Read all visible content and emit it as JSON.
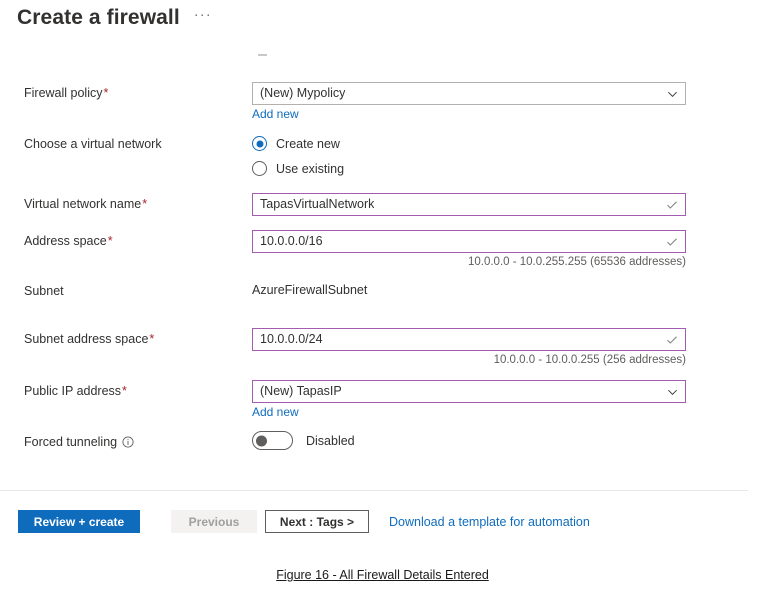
{
  "header": {
    "title": "Create a firewall",
    "more_label": "···"
  },
  "form": {
    "fields": {
      "firewall_policy": {
        "label": "Firewall policy",
        "required_mark": "*",
        "value": "(New) Mypolicy",
        "add_new_label": "Add new",
        "control": "dropdown",
        "border_color": "#b3b0ad"
      },
      "choose_vnet": {
        "label": "Choose a virtual network",
        "options": [
          {
            "label": "Create new",
            "selected": true
          },
          {
            "label": "Use existing",
            "selected": false
          }
        ]
      },
      "vnet_name": {
        "label": "Virtual network name",
        "required_mark": "*",
        "value": "TapasVirtualNetwork",
        "control": "textbox",
        "border_color": "#a35cb0",
        "validation_icon": "checkmark-icon"
      },
      "address_space": {
        "label": "Address space",
        "required_mark": "*",
        "value": "10.0.0.0/16",
        "control": "textbox",
        "border_color": "#a35cb0",
        "validation_icon": "checkmark-icon",
        "helper": "10.0.0.0 - 10.0.255.255 (65536 addresses)"
      },
      "subnet": {
        "label": "Subnet",
        "value": "AzureFirewallSubnet"
      },
      "subnet_address_space": {
        "label": "Subnet address space",
        "required_mark": "*",
        "value": "10.0.0.0/24",
        "control": "textbox",
        "border_color": "#a35cb0",
        "validation_icon": "checkmark-icon",
        "helper": "10.0.0.0 - 10.0.0.255 (256 addresses)"
      },
      "public_ip": {
        "label": "Public IP address",
        "required_mark": "*",
        "value": "(New) TapasIP",
        "add_new_label": "Add new",
        "control": "dropdown",
        "border_color": "#a35cb0"
      },
      "forced_tunneling": {
        "label": "Forced tunneling",
        "info_icon": "info-icon",
        "state_label": "Disabled",
        "enabled": false
      }
    }
  },
  "footer": {
    "review_create_label": "Review + create",
    "previous_label": "Previous",
    "next_label": "Next : Tags >",
    "download_template_label": "Download a template for automation",
    "primary_color": "#0f6cbd",
    "link_color": "#0f6cbd"
  },
  "caption": {
    "text": "Figure 16 - All Firewall Details Entered"
  }
}
